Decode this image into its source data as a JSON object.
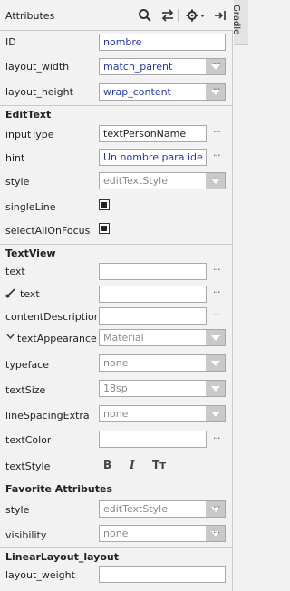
{
  "gradle_tab": "Gradle",
  "toolbar": {
    "title": "Attributes",
    "icons": [
      "search-icon",
      "swap-icon",
      "gear-icon",
      "pin-icon"
    ]
  },
  "layout_rows": {
    "id": {
      "label": "ID",
      "value": "nombre"
    },
    "layout_width": {
      "label": "layout_width",
      "value": "match_parent"
    },
    "layout_height": {
      "label": "layout_height",
      "value": "wrap_content"
    }
  },
  "edittext": {
    "title": "EditText",
    "inputType": {
      "label": "inputType",
      "value": "textPersonName"
    },
    "hint": {
      "label": "hint",
      "value": "Un nombre para ide"
    },
    "style": {
      "label": "style",
      "value": "editTextStyle"
    },
    "singleLine": {
      "label": "singleLine",
      "checked": true
    },
    "selectAllOnFocus": {
      "label": "selectAllOnFocus",
      "checked": true
    }
  },
  "textview": {
    "title": "TextView",
    "text": {
      "label": "text",
      "value": ""
    },
    "text_tools": {
      "label": "text",
      "value": ""
    },
    "contentDescription": {
      "label": "contentDescriptior",
      "value": ""
    },
    "textAppearance": {
      "label": "textAppearance",
      "value": "Material"
    },
    "typeface": {
      "label": "typeface",
      "value": "none"
    },
    "textSize": {
      "label": "textSize",
      "value": "18sp"
    },
    "lineSpacingExtra": {
      "label": "lineSpacingExtra",
      "value": "none"
    },
    "textColor": {
      "label": "textColor",
      "value": ""
    },
    "textStyle": {
      "label": "textStyle",
      "buttons": [
        "B",
        "I",
        "Tт"
      ]
    }
  },
  "favorites": {
    "title": "Favorite Attributes",
    "style": {
      "label": "style",
      "value": "editTextStyle"
    },
    "visibility": {
      "label": "visibility",
      "value": "none"
    }
  },
  "linearlayout": {
    "title": "LinearLayout_layout",
    "layout_weight": {
      "label": "layout_weight",
      "value": ""
    }
  },
  "colors": {
    "panel_bg": "#f2f2f2",
    "value_blue": "#2437b4",
    "dropdown_button": "#c9c9c9",
    "divider": "#c9c9c9"
  }
}
